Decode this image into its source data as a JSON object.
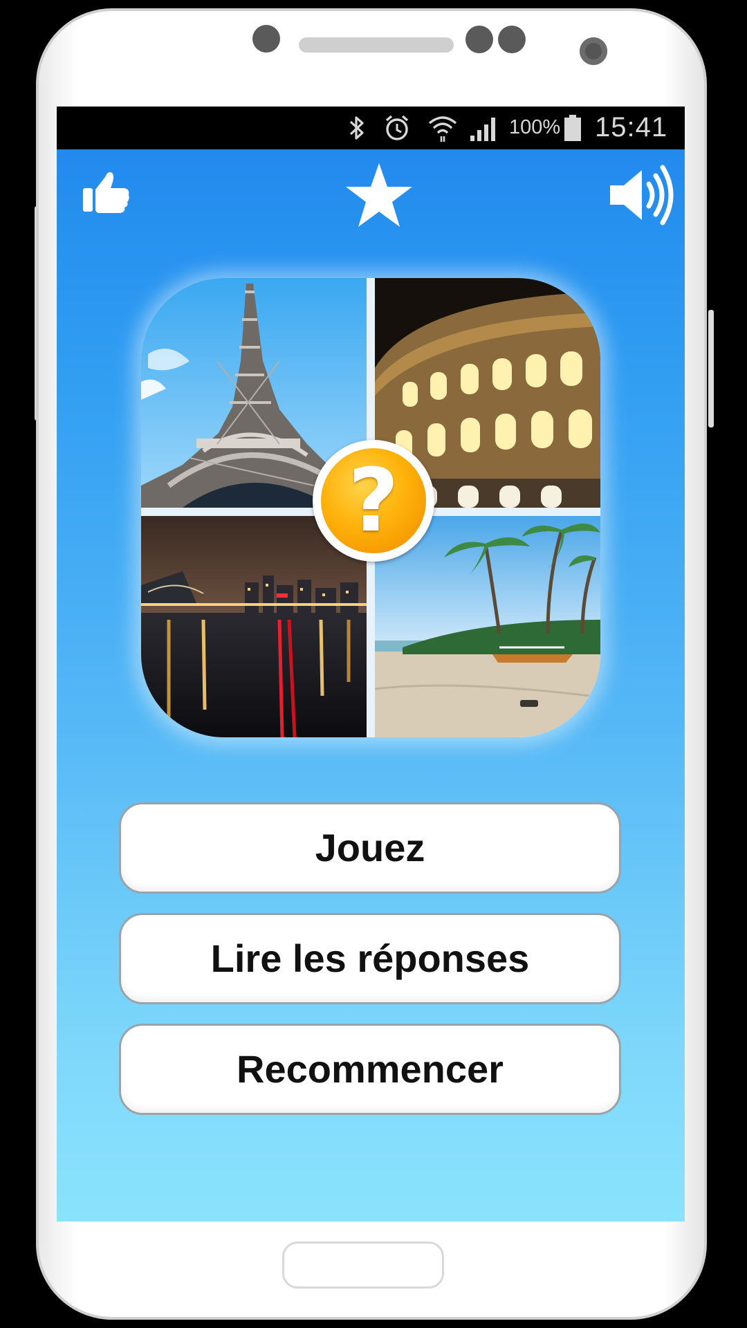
{
  "statusbar": {
    "battery_percent": "100%",
    "time": "15:41",
    "icons": [
      "bluetooth-icon",
      "alarm-icon",
      "wifi-icon",
      "signal-icon",
      "battery-icon"
    ]
  },
  "toolbar": {
    "icons": [
      "thumbs-up-icon",
      "star-icon",
      "sound-icon"
    ]
  },
  "puzzle": {
    "badge_text": "?",
    "images": [
      "eiffel-tower-image",
      "colosseum-image",
      "city-night-image",
      "tropical-beach-image"
    ]
  },
  "menu": {
    "play_label": "Jouez",
    "answers_label": "Lire les réponses",
    "restart_label": "Recommencer"
  },
  "colors": {
    "background_top": "#1f86ec",
    "background_bottom": "#8ae3fc",
    "badge": "#ffb20a"
  }
}
